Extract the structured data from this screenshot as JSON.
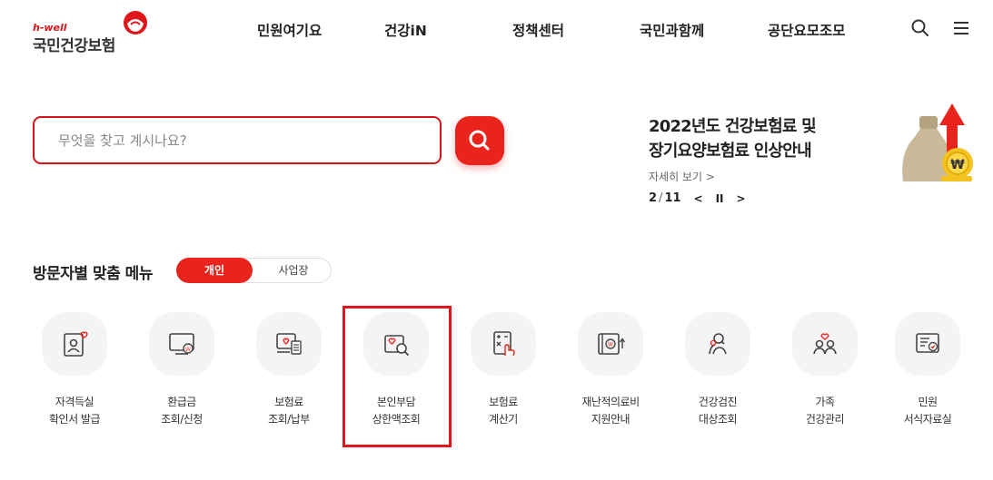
{
  "header": {
    "logo_tag": "h-well",
    "logo_text": "국민건강보험",
    "nav": [
      "민원여기요",
      "건강iN",
      "정책센터",
      "국민과함께",
      "공단요모조모"
    ],
    "icons": [
      "search-icon",
      "menu-icon"
    ]
  },
  "search": {
    "placeholder": "무엇을 찾고 계시나요?",
    "value": ""
  },
  "banner": {
    "title_line1": "2022년도 건강보험료 및",
    "title_line2": "장기요양보험료 인상안내",
    "more": "자세히 보기 >",
    "current": "2",
    "total": "11",
    "prev": "<",
    "pause": "II",
    "next": ">"
  },
  "visitor_menu": {
    "title": "방문자별 맞춤 메뉴",
    "tabs": [
      "개인",
      "사업장"
    ],
    "active_tab": "개인",
    "items": [
      {
        "line1": "자격득실",
        "line2": "확인서 발급",
        "icon": "certificate-icon"
      },
      {
        "line1": "환급금",
        "line2": "조회/신청",
        "icon": "refund-monitor-icon"
      },
      {
        "line1": "보험료",
        "line2": "조회/납부",
        "icon": "insurance-payment-icon"
      },
      {
        "line1": "본인부담",
        "line2": "상한액조회",
        "icon": "copay-search-icon"
      },
      {
        "line1": "보험료",
        "line2": "계산기",
        "icon": "calculator-icon"
      },
      {
        "line1": "재난적의료비",
        "line2": "지원안내",
        "icon": "medical-support-icon"
      },
      {
        "line1": "건강검진",
        "line2": "대상조회",
        "icon": "checkup-people-icon"
      },
      {
        "line1": "가족",
        "line2": "건강관리",
        "icon": "family-care-icon"
      },
      {
        "line1": "민원",
        "line2": "서식자료실",
        "icon": "document-form-icon"
      }
    ]
  },
  "colors": {
    "accent": "#e8241c",
    "highlight_border": "#e0161c"
  }
}
